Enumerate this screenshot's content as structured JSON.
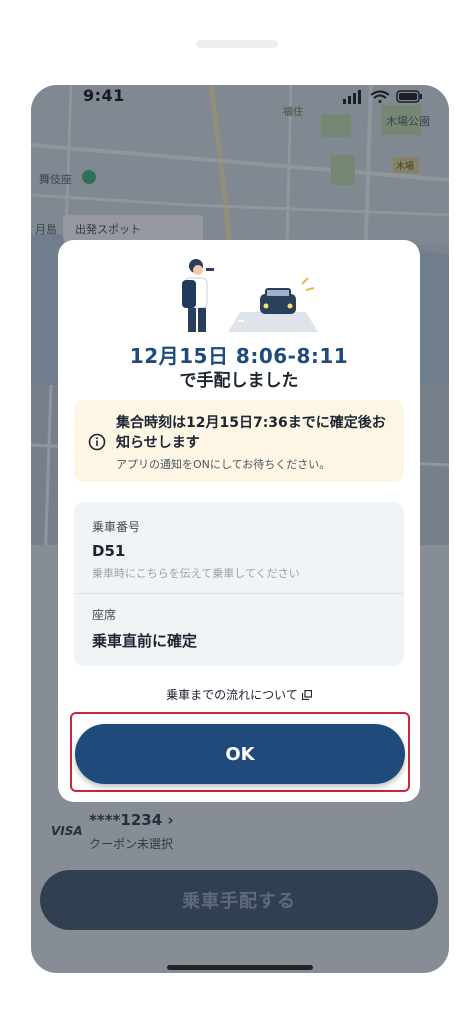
{
  "status_bar": {
    "time": "9:41"
  },
  "map": {
    "labels": [
      "舞伎座",
      "福住",
      "木場公園",
      "月島",
      "出発スポット",
      "木場"
    ]
  },
  "payment": {
    "card_brand": "VISA",
    "card_number": "****1234 ›",
    "coupon": "クーポン未選択"
  },
  "request_button": {
    "label": "乗車手配する"
  },
  "modal": {
    "title_line1": "12月15日 8:06-8:11",
    "title_line2": "で手配しました",
    "notice": {
      "title": "集合時刻は12月15日7:36までに確定後お知らせします",
      "subtitle": "アプリの通知をONにしてお待ちください。"
    },
    "boarding_number": {
      "label": "乗車番号",
      "value": "D51",
      "hint": "乗車時にこちらを伝えて乗車してください"
    },
    "seat": {
      "label": "座席",
      "value": "乗車直前に確定"
    },
    "flow_link": "乗車までの流れについて",
    "ok_button": "OK"
  },
  "colors": {
    "accent": "#1e4b7c",
    "highlight_border": "#c8263a",
    "notice_bg": "#fdf6e4",
    "info_bg": "#f1f4f7"
  }
}
